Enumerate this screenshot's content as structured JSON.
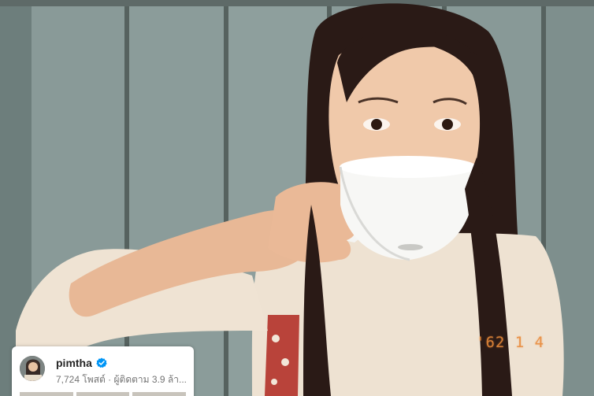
{
  "photo": {
    "description_icon": "photo-icon",
    "date_stamp": "'62 1 4"
  },
  "profile": {
    "username": "pimtha",
    "verified_icon": "verified-badge-icon",
    "meta": "7,724 โพสต์ · ผู้ติดตาม 3.9 ล้า...",
    "accent_color": "#0095f6"
  }
}
